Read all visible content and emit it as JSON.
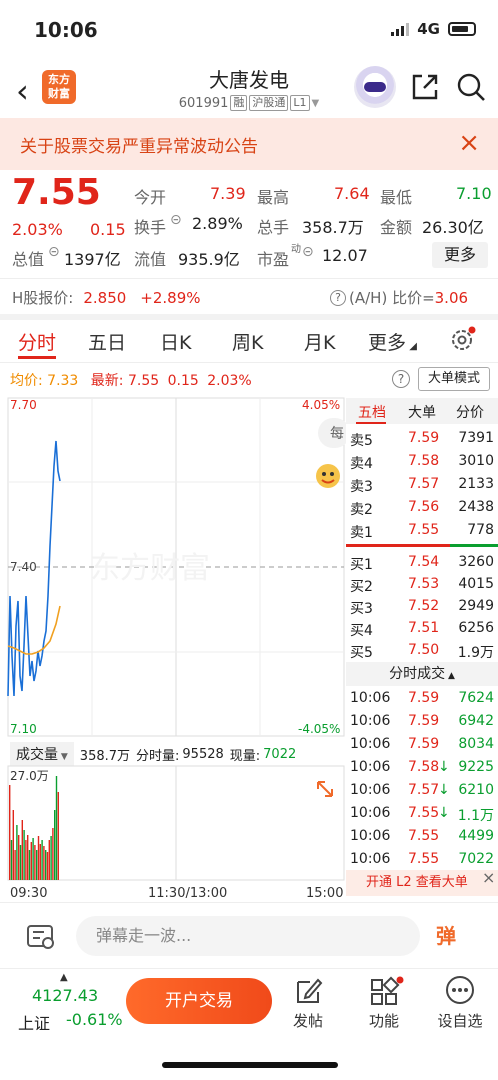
{
  "status_bar": {
    "time": "10:06",
    "network": "4G"
  },
  "header": {
    "logo_line1": "东方",
    "logo_line2": "财富",
    "title": "大唐发电",
    "code": "601991",
    "tag1": "融",
    "tag2": "沪股通",
    "tag3": "L1"
  },
  "notice": {
    "text": "关于股票交易严重异常波动公告"
  },
  "quote": {
    "price": "7.55",
    "change_pct": "2.03%",
    "change": "0.15",
    "open_label": "今开",
    "open": "7.39",
    "high_label": "最高",
    "high": "7.64",
    "low_label": "最低",
    "low": "7.10",
    "turnover_label": "换手",
    "turnover": "2.89%",
    "volume_label": "总手",
    "volume": "358.7万",
    "amount_label": "金额",
    "amount": "26.30亿",
    "mktcap_label": "总值",
    "mktcap": "1397亿",
    "float_label": "流值",
    "float": "935.9亿",
    "pe_label": "市盈",
    "pe_sup": "动",
    "pe": "12.07",
    "more": "更多"
  },
  "hshare": {
    "label": "H股报价:",
    "price": "2.850",
    "pct": "+2.89%",
    "ah_label": "(A/H) 比价=",
    "ah": "3.06"
  },
  "tabs": [
    "分时",
    "五日",
    "日K",
    "周K",
    "月K",
    "更多"
  ],
  "chart_info": {
    "avg_label": "均价:",
    "avg": "7.33",
    "latest_label": "最新:",
    "latest": "7.55",
    "chg": "0.15",
    "pct": "2.03%",
    "big_order_mode": "大单模式"
  },
  "chart_axes": {
    "top_price": "7.70",
    "mid_price": "7.40",
    "bottom_price": "7.10",
    "top_pct": "4.05%",
    "bottom_pct": "-4.05%",
    "t_start": "09:30",
    "t_mid": "11:30/13:00",
    "t_end": "15:00",
    "watermark": "东方财富",
    "bubble": "每"
  },
  "volume_bar": {
    "select": "成交量",
    "total": "358.7万",
    "tick_label": "分时量:",
    "tick": "95528",
    "now_label": "现量:",
    "now": "7022",
    "max": "27.0万"
  },
  "order_book": {
    "tabs": [
      "五档",
      "大单",
      "分价"
    ],
    "asks": [
      {
        "label": "卖5",
        "price": "7.59",
        "vol": "7391"
      },
      {
        "label": "卖4",
        "price": "7.58",
        "vol": "3010"
      },
      {
        "label": "卖3",
        "price": "7.57",
        "vol": "2133"
      },
      {
        "label": "卖2",
        "price": "7.56",
        "vol": "2438"
      },
      {
        "label": "卖1",
        "price": "7.55",
        "vol": "778"
      }
    ],
    "bids": [
      {
        "label": "买1",
        "price": "7.54",
        "vol": "3260"
      },
      {
        "label": "买2",
        "price": "7.53",
        "vol": "4015"
      },
      {
        "label": "买3",
        "price": "7.52",
        "vol": "2949"
      },
      {
        "label": "买4",
        "price": "7.51",
        "vol": "6256"
      },
      {
        "label": "买5",
        "price": "7.50",
        "vol": "1.9万"
      }
    ],
    "trades_title": "分时成交",
    "trades": [
      {
        "time": "10:06",
        "price": "7.59",
        "vol": "7624",
        "color": "green",
        "arrow": ""
      },
      {
        "time": "10:06",
        "price": "7.59",
        "vol": "6942",
        "color": "green",
        "arrow": ""
      },
      {
        "time": "10:06",
        "price": "7.59",
        "vol": "8034",
        "color": "green",
        "arrow": ""
      },
      {
        "time": "10:06",
        "price": "7.58",
        "vol": "9225",
        "color": "green",
        "arrow": "↓"
      },
      {
        "time": "10:06",
        "price": "7.57",
        "vol": "6210",
        "color": "green",
        "arrow": "↓"
      },
      {
        "time": "10:06",
        "price": "7.55",
        "vol": "1.1万",
        "color": "green",
        "arrow": "↓"
      },
      {
        "time": "10:06",
        "price": "7.55",
        "vol": "4499",
        "color": "green",
        "arrow": ""
      },
      {
        "time": "10:06",
        "price": "7.55",
        "vol": "7022",
        "color": "green",
        "arrow": ""
      }
    ],
    "l2_promo": "开通 L2 查看大单"
  },
  "danmu": {
    "placeholder": "弹幕走一波...",
    "dan": "弹"
  },
  "bottom_nav": {
    "index_value": "4127.43",
    "index_name": "上证",
    "index_pct": "-0.61%",
    "trade": "开户交易",
    "post": "发帖",
    "function": "功能",
    "watchlist": "设自选"
  }
}
